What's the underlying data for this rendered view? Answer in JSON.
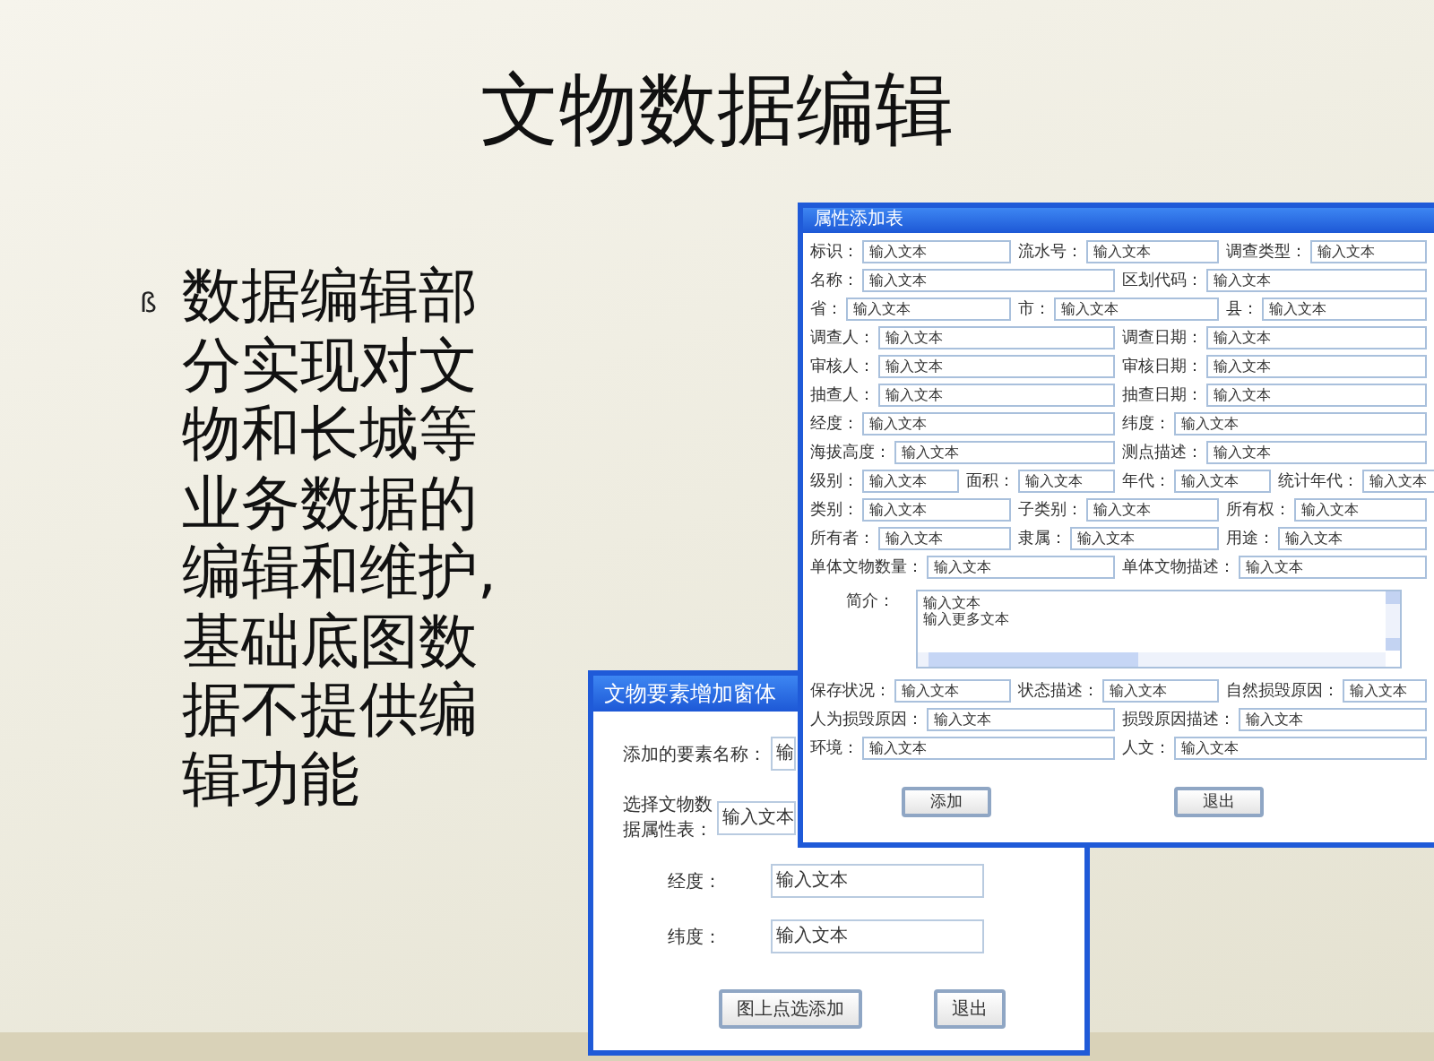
{
  "slide": {
    "title": "文物数据编辑",
    "bullet": {
      "marker": "ß",
      "text": "数据编辑部分实现对文物和长城等业务数据的编辑和维护,基础底图数据不提供编辑功能"
    }
  },
  "element_window": {
    "title": "文物要素增加窗体",
    "fields": [
      {
        "label": "添加的要素名称：",
        "value": "输"
      },
      {
        "label": "选择文物数据属性表：",
        "value": "输入文本"
      },
      {
        "label": "经度：",
        "value": "输入文本"
      },
      {
        "label": "纬度：",
        "value": "输入文本"
      }
    ],
    "buttons": [
      "图上点选添加",
      "退出"
    ]
  },
  "attribute_window": {
    "title": "属性添加表",
    "items": [
      {
        "kind": "fields",
        "fields": [
          {
            "label": "标识：",
            "value": "输入文本"
          },
          {
            "label": "流水号：",
            "value": "输入文本"
          },
          {
            "label": "调查类型：",
            "value": "输入文本"
          }
        ]
      },
      {
        "kind": "fields",
        "fields": [
          {
            "label": "名称：",
            "value": "输入文本"
          },
          {
            "label": "区划代码：",
            "value": "输入文本"
          }
        ]
      },
      {
        "kind": "fields",
        "fields": [
          {
            "label": "省：",
            "value": "输入文本"
          },
          {
            "label": "市：",
            "value": "输入文本"
          },
          {
            "label": "县：",
            "value": "输入文本"
          }
        ]
      },
      {
        "kind": "fields",
        "fields": [
          {
            "label": "调查人：",
            "value": "输入文本"
          },
          {
            "label": "调查日期：",
            "value": "输入文本"
          }
        ]
      },
      {
        "kind": "fields",
        "fields": [
          {
            "label": "审核人：",
            "value": "输入文本"
          },
          {
            "label": "审核日期：",
            "value": "输入文本"
          }
        ]
      },
      {
        "kind": "fields",
        "fields": [
          {
            "label": "抽查人：",
            "value": "输入文本"
          },
          {
            "label": "抽查日期：",
            "value": "输入文本"
          }
        ]
      },
      {
        "kind": "fields",
        "fields": [
          {
            "label": "经度：",
            "value": "输入文本"
          },
          {
            "label": "纬度：",
            "value": "输入文本"
          }
        ]
      },
      {
        "kind": "fields",
        "fields": [
          {
            "label": "海拔高度：",
            "value": "输入文本"
          },
          {
            "label": "测点描述：",
            "value": "输入文本"
          }
        ]
      },
      {
        "kind": "fields",
        "fields": [
          {
            "label": "级别：",
            "value": "输入文本"
          },
          {
            "label": "面积：",
            "value": "输入文本"
          },
          {
            "label": "年代：",
            "value": "输入文本"
          },
          {
            "label": "统计年代：",
            "value": "输入文本"
          }
        ]
      },
      {
        "kind": "fields",
        "fields": [
          {
            "label": "类别：",
            "value": "输入文本"
          },
          {
            "label": "子类别：",
            "value": "输入文本"
          },
          {
            "label": "所有权：",
            "value": "输入文本"
          }
        ]
      },
      {
        "kind": "fields",
        "fields": [
          {
            "label": "所有者：",
            "value": "输入文本"
          },
          {
            "label": "隶属：",
            "value": "输入文本"
          },
          {
            "label": "用途：",
            "value": "输入文本"
          }
        ]
      },
      {
        "kind": "fields",
        "fields": [
          {
            "label": "单体文物数量：",
            "value": "输入文本"
          },
          {
            "label": "单体文物描述：",
            "value": "输入文本"
          }
        ]
      },
      {
        "kind": "textarea",
        "label": "简介：",
        "lines": [
          "输入文本",
          "输入更多文本"
        ]
      },
      {
        "kind": "fields",
        "fields": [
          {
            "label": "保存状况：",
            "value": "输入文本"
          },
          {
            "label": "状态描述：",
            "value": "输入文本"
          },
          {
            "label": "自然损毁原因：",
            "value": "输入文本"
          }
        ]
      },
      {
        "kind": "fields",
        "fields": [
          {
            "label": "人为损毁原因：",
            "value": "输入文本"
          },
          {
            "label": "损毁原因描述：",
            "value": "输入文本"
          }
        ]
      },
      {
        "kind": "fields",
        "fields": [
          {
            "label": "环境：",
            "value": "输入文本"
          },
          {
            "label": "人文：",
            "value": "输入文本"
          }
        ]
      }
    ],
    "buttons": [
      "添加",
      "退出"
    ]
  }
}
